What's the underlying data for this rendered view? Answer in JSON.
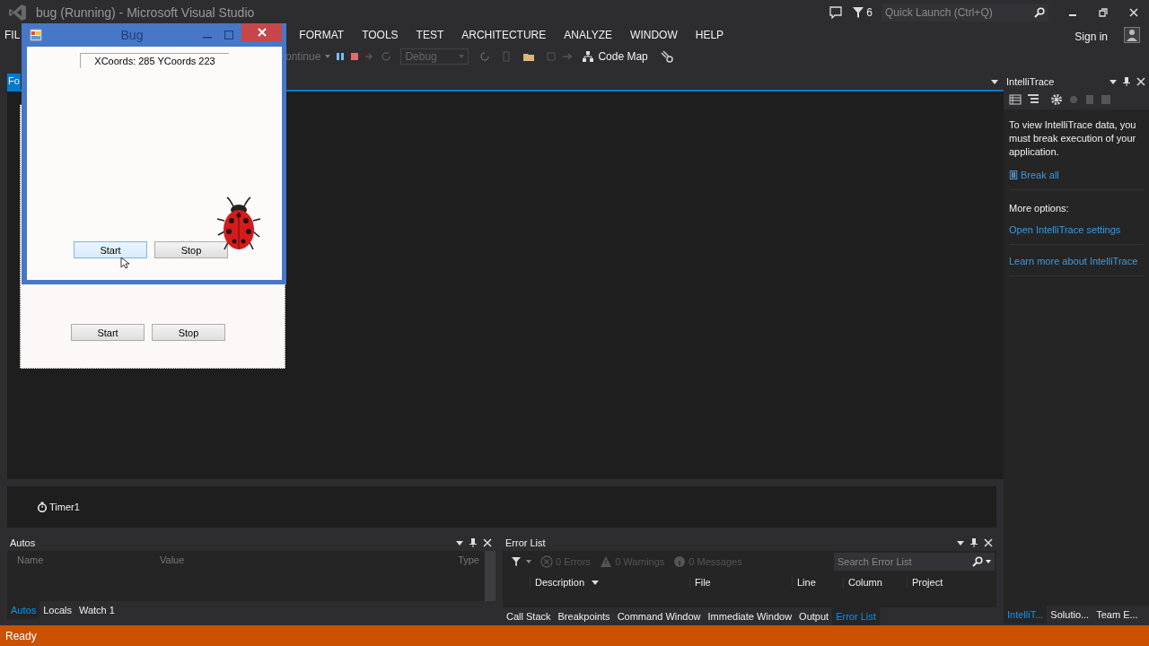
{
  "window": {
    "title": "bug (Running) - Microsoft Visual Studio"
  },
  "notification_count": "6",
  "quick_launch": {
    "placeholder": "Quick Launch (Ctrl+Q)"
  },
  "sign_in": "Sign in",
  "menu": [
    "FIL",
    "FORMAT",
    "TOOLS",
    "TEST",
    "ARCHITECTURE",
    "ANALYZE",
    "WINDOW",
    "HELP"
  ],
  "toolbar": {
    "continue": "ontinue",
    "configuration": "Debug",
    "code_map": "Code Map"
  },
  "document_tab": {
    "label": "Fo",
    "selected": true
  },
  "designer_form": {
    "buttons": [
      "Start",
      "Stop"
    ]
  },
  "component_tray": [
    "Timer1"
  ],
  "running_app": {
    "title": "Bug",
    "coords": "XCoords: 285 YCoords 223",
    "buttons": [
      {
        "label": "Start",
        "hovered": true
      },
      {
        "label": "Stop",
        "hovered": false
      }
    ]
  },
  "intellitrace": {
    "title": "IntelliTrace",
    "message": "To view IntelliTrace data, you must break execution of your application.",
    "break_all": "Break all",
    "more_options": "More options:",
    "links": [
      "Open IntelliTrace settings",
      "Learn more about IntelliTrace"
    ]
  },
  "autos": {
    "title": "Autos",
    "columns": [
      "Name",
      "Value",
      "Type"
    ],
    "tabs": [
      {
        "label": "Autos",
        "selected": true
      },
      {
        "label": "Locals",
        "selected": false
      },
      {
        "label": "Watch 1",
        "selected": false
      }
    ]
  },
  "error_list": {
    "title": "Error List",
    "filters": [
      {
        "label": "0 Errors",
        "kind": "error"
      },
      {
        "label": "0 Warnings",
        "kind": "warning"
      },
      {
        "label": "0 Messages",
        "kind": "message"
      }
    ],
    "search": {
      "placeholder": "Search Error List"
    },
    "columns": [
      "Description",
      "File",
      "Line",
      "Column",
      "Project"
    ],
    "tabs": [
      {
        "label": "Call Stack",
        "selected": false
      },
      {
        "label": "Breakpoints",
        "selected": false
      },
      {
        "label": "Command Window",
        "selected": false
      },
      {
        "label": "Immediate Window",
        "selected": false
      },
      {
        "label": "Output",
        "selected": false
      },
      {
        "label": "Error List",
        "selected": true
      }
    ]
  },
  "right_tabs": [
    {
      "label": "IntelliT...",
      "selected": true
    },
    {
      "label": "Solutio...",
      "selected": false
    },
    {
      "label": "Team E...",
      "selected": false
    }
  ],
  "status_bar": "Ready"
}
